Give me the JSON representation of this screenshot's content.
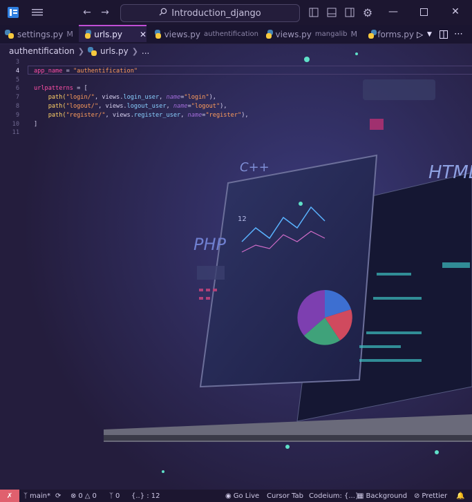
{
  "titlebar": {
    "search_text": "Introduction_django"
  },
  "tabs": [
    {
      "label": "settings.py",
      "desc": "",
      "mod": "M",
      "active": false
    },
    {
      "label": "urls.py",
      "desc": "",
      "mod": "",
      "active": true
    },
    {
      "label": "views.py",
      "desc": "authentification",
      "mod": "",
      "active": false
    },
    {
      "label": "views.py",
      "desc": "mangalib",
      "mod": "M",
      "active": false
    },
    {
      "label": "forms.py",
      "desc": "",
      "mod": "",
      "active": false
    }
  ],
  "breadcrumb": {
    "folder": "authentification",
    "file": "urls.py",
    "symbol": "..."
  },
  "editor": {
    "current_line": "4",
    "lines": [
      {
        "n": "3",
        "code": ""
      },
      {
        "n": "4",
        "code": "app_name = \"authentification\""
      },
      {
        "n": "5",
        "code": ""
      },
      {
        "n": "6",
        "code": "urlpatterns = ["
      },
      {
        "n": "7",
        "code": "    path(\"login/\", views.login_user, name=\"login\"),"
      },
      {
        "n": "8",
        "code": "    path(\"logout/\", views.logout_user, name=\"logout\"),"
      },
      {
        "n": "9",
        "code": "    path(\"register/\", views.register_user, name=\"register\"),"
      },
      {
        "n": "10",
        "code": "]"
      },
      {
        "n": "11",
        "code": ""
      }
    ]
  },
  "statusbar": {
    "branch": "main*",
    "errors": "0",
    "warnings": "0",
    "info": "0",
    "selection": "{..} : 12",
    "golive": "Go Live",
    "cursor_tab": "Cursor Tab",
    "codeium": "Codeium: {...}",
    "background": "Background",
    "prettier": "Prettier"
  },
  "bg_text": {
    "cpp": "C++",
    "html": "HTML",
    "php": "PHP",
    "code12": "12"
  },
  "colors": {
    "accent": "#c14fd6",
    "status_remote": "#e0606e",
    "string": "#ff9d5c",
    "variable": "#ff4fa7",
    "function": "#ffd166"
  }
}
